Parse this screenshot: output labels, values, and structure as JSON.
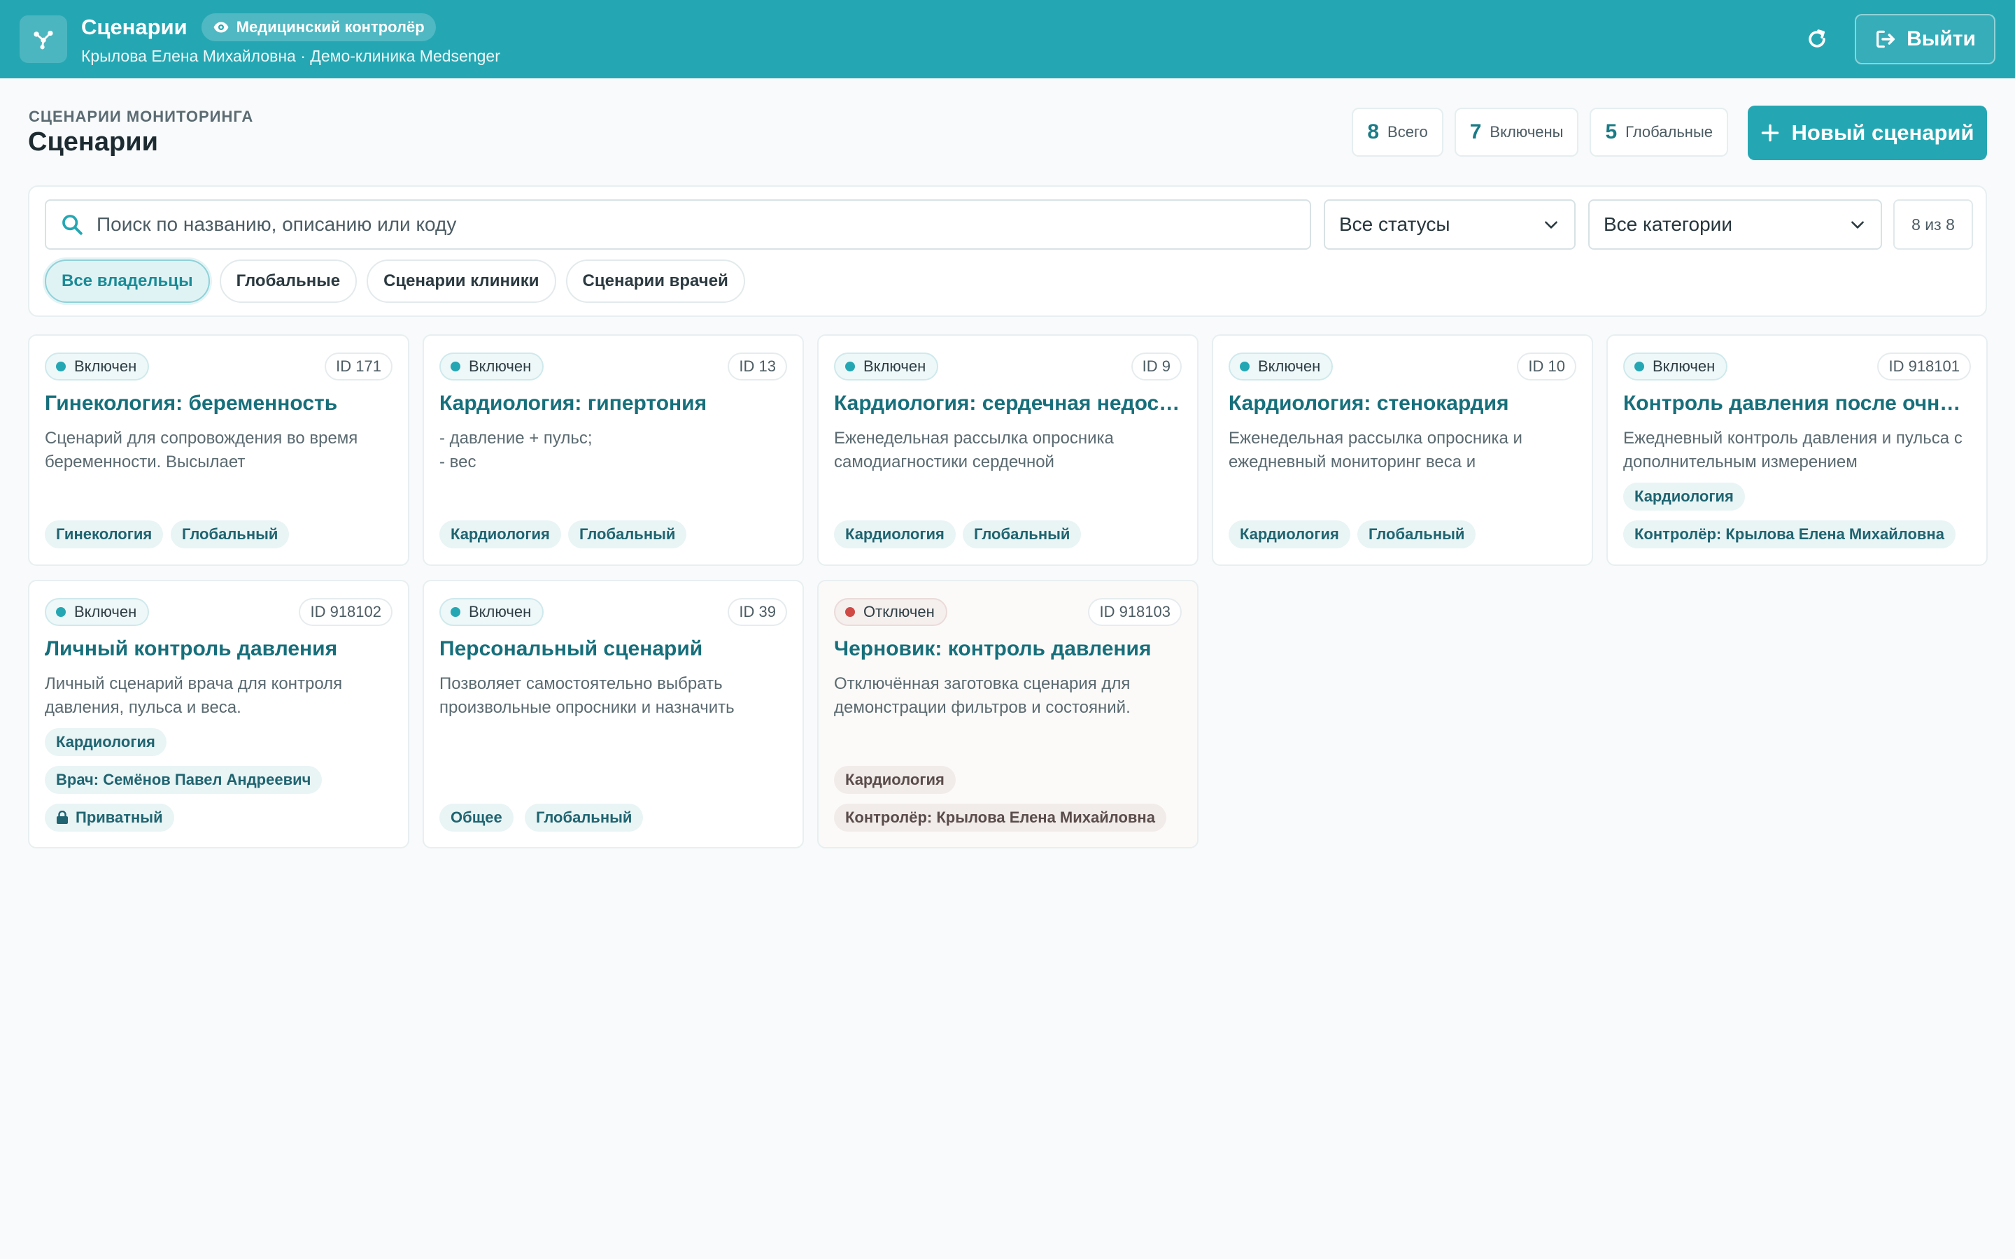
{
  "header": {
    "title": "Сценарии",
    "role_badge": "Медицинский контролёр",
    "user_line": "Крылова Елена Михайловна · Демо-клиника Medsenger",
    "logout_label": "Выйти",
    "logo_icon": "flow-nodes-icon",
    "accent": "#25a7b3"
  },
  "page": {
    "eyebrow": "СЦЕНАРИИ МОНИТОРИНГА",
    "title": "Сценарии",
    "new_button_label": "Новый сценарий"
  },
  "stats": [
    {
      "value": "8",
      "label": "Всего"
    },
    {
      "value": "7",
      "label": "Включены"
    },
    {
      "value": "5",
      "label": "Глобальные"
    }
  ],
  "filters": {
    "search_placeholder": "Поиск по названию, описанию или коду",
    "status_select": "Все статусы",
    "category_select": "Все категории",
    "count": "8 из 8",
    "owner_tabs": [
      "Все владельцы",
      "Глобальные",
      "Сценарии клиники",
      "Сценарии врачей"
    ],
    "active_owner_tab": 0
  },
  "cards": [
    {
      "status": "Включен",
      "id": "ID 171",
      "title": "Гинекология: беременность",
      "desc": "Сценарий для сопровождения во время беременности. Высылает",
      "tags": [
        "Гинекология",
        "Глобальный"
      ]
    },
    {
      "status": "Включен",
      "id": "ID 13",
      "title": "Кардиология: гипертония",
      "desc": "- давление + пульс;\n- вес",
      "tags": [
        "Кардиология",
        "Глобальный"
      ]
    },
    {
      "status": "Включен",
      "id": "ID 9",
      "title": "Кардиология: сердечная недостаточность",
      "desc": "Еженедельная рассылка опросника самодиагностики сердечной",
      "tags": [
        "Кардиология",
        "Глобальный"
      ]
    },
    {
      "status": "Включен",
      "id": "ID 10",
      "title": "Кардиология: стенокардия",
      "desc": "Еженедельная рассылка опросника и ежедневный мониторинг веса и",
      "tags": [
        "Кардиология",
        "Глобальный"
      ]
    },
    {
      "status": "Включен",
      "id": "ID 918101",
      "title": "Контроль давления после очного приёма",
      "desc": "Ежедневный контроль давления и пульса с дополнительным измерением",
      "tags": [
        "Кардиология",
        "Контролёр: Крылова Елена Михайловна"
      ]
    },
    {
      "status": "Включен",
      "id": "ID 918102",
      "title": "Личный контроль давления",
      "desc": "Личный сценарий врача для контроля давления, пульса и веса.",
      "tags": [
        "Кардиология",
        "Врач: Семёнов Павел Андреевич",
        "Приватный"
      ]
    },
    {
      "status": "Включен",
      "id": "ID 39",
      "title": "Персональный сценарий",
      "desc": "Позволяет самостоятельно выбрать произвольные опросники и назначить",
      "tags": [
        "Общее",
        "Глобальный"
      ]
    },
    {
      "status": "Отключен",
      "id": "ID 918103",
      "title": "Черновик: контроль давления",
      "desc": "Отключённая заготовка сценария для демонстрации фильтров и состояний.",
      "tags": [
        "Кардиология",
        "Контролёр: Крылова Елена Михайловна"
      ]
    }
  ]
}
